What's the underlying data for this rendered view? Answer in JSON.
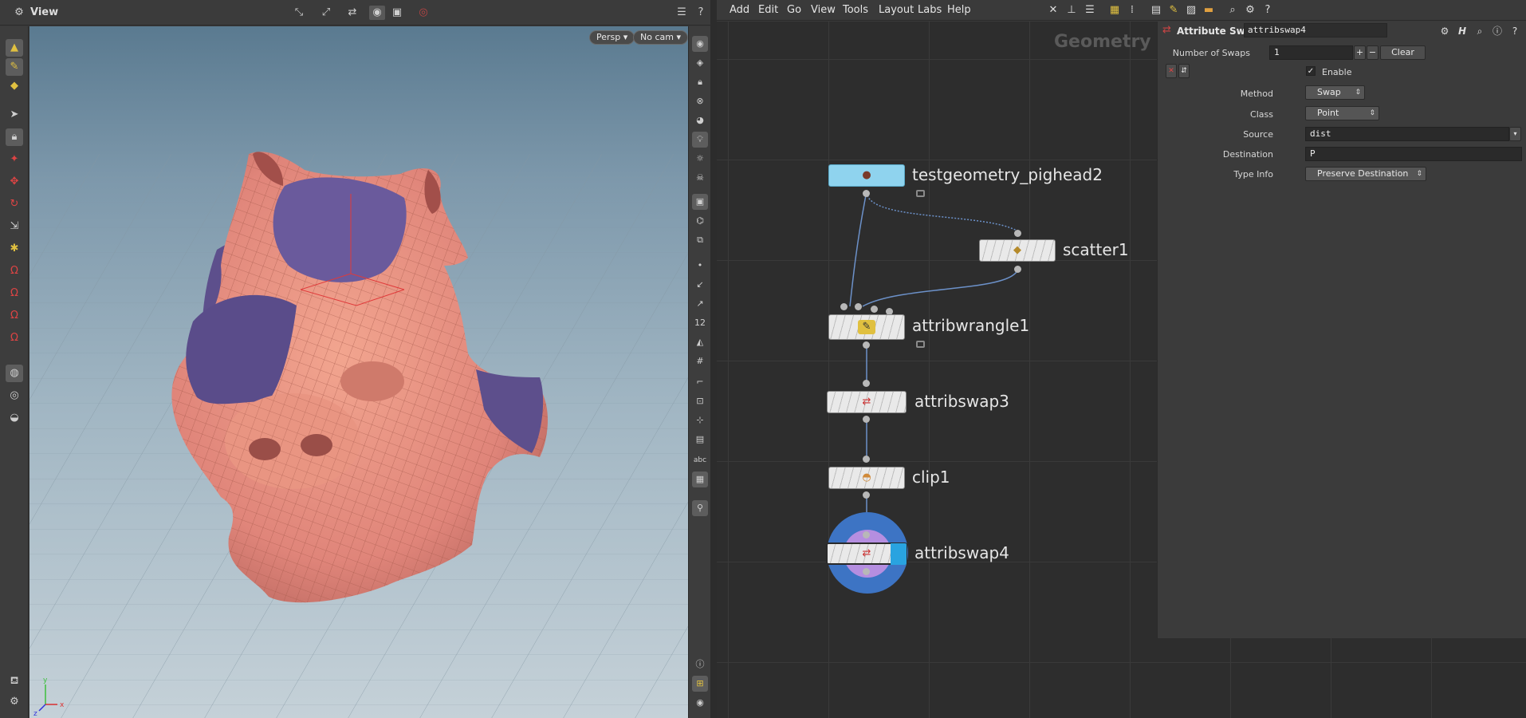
{
  "viewer": {
    "title": "View",
    "persp_label": "Persp",
    "cam_label": "No cam",
    "axis_x": "x",
    "axis_y": "y",
    "axis_z": "z"
  },
  "right_toolbar": {
    "numeric_label": "12",
    "abc_label": "abc"
  },
  "menu": {
    "items": [
      "Add",
      "Edit",
      "Go",
      "View",
      "Tools",
      "Layout",
      "Labs",
      "Help"
    ]
  },
  "network": {
    "context_label": "Geometry",
    "nodes": [
      {
        "name": "testgeometry_pighead2",
        "icon": "pighead-icon",
        "color": "#8fd3ee"
      },
      {
        "name": "scatter1",
        "icon": "scatter-icon",
        "color": "#e8e8e8"
      },
      {
        "name": "attribwrangle1",
        "icon": "wrangle-icon",
        "color": "#e8e8e8"
      },
      {
        "name": "attribswap3",
        "icon": "swap-icon",
        "color": "#e8e8e8"
      },
      {
        "name": "clip1",
        "icon": "clip-icon",
        "color": "#e8e8e8"
      },
      {
        "name": "attribswap4",
        "icon": "swap-icon",
        "color": "#e8e8e8",
        "selected": true,
        "display_flag_color": "#29a3e0"
      }
    ]
  },
  "params": {
    "node_type": "Attribute Swap",
    "node_name": "attribswap4",
    "num_swaps_label": "Number of Swaps",
    "num_swaps_value": "1",
    "plus_label": "+",
    "minus_label": "−",
    "clear_label": "Clear",
    "enable_label": "Enable",
    "method_label": "Method",
    "method_value": "Swap",
    "class_label": "Class",
    "class_value": "Point",
    "source_label": "Source",
    "source_value": "dist",
    "destination_label": "Destination",
    "destination_value": "P",
    "typeinfo_label": "Type Info",
    "typeinfo_value": "Preserve Destination"
  },
  "colors": {
    "mesh": "#e8907c",
    "mesh_back": "#5d4f8c",
    "selection_ring": "#3d74c4",
    "selection_inner": "#b58ee0"
  }
}
